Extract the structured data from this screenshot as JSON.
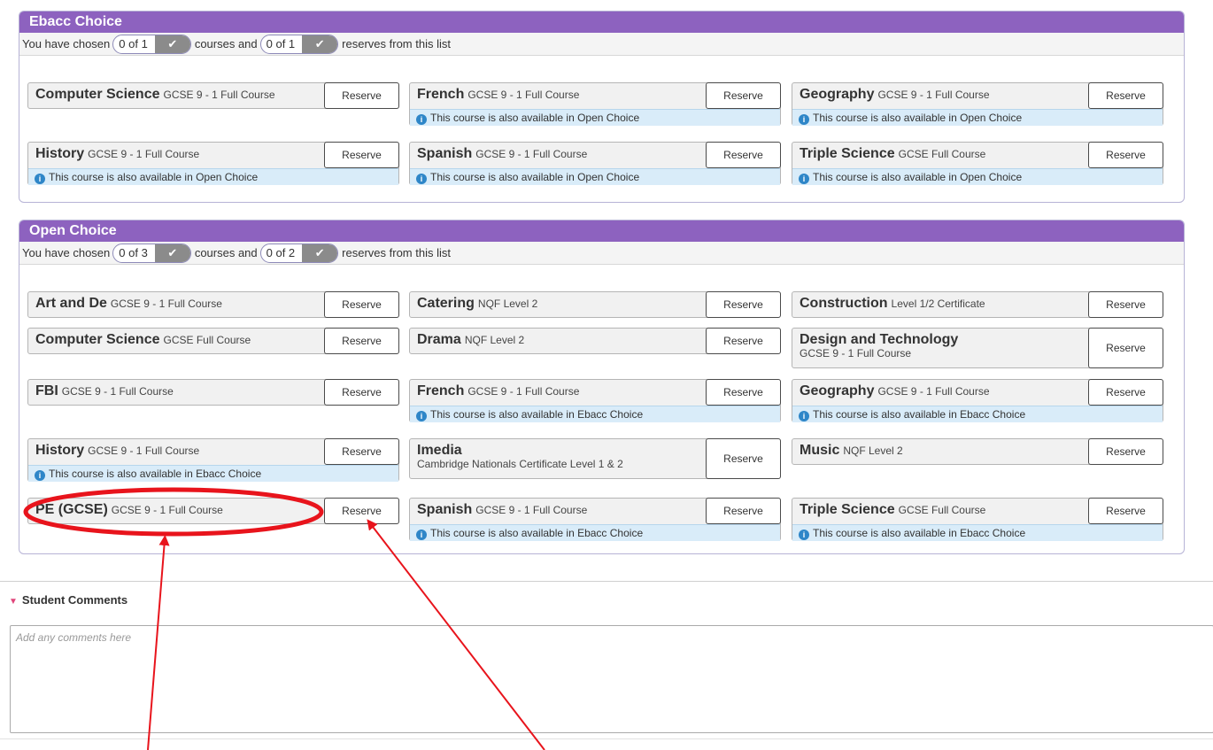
{
  "ebacc": {
    "title": "Ebacc Choice",
    "chosen_prefix": "You have chosen",
    "courses_value": "0 of 1",
    "courses_mid": "courses and",
    "reserves_value": "0 of 1",
    "reserves_suffix": "reserves from this list",
    "courses": [
      {
        "name": "Computer Science",
        "level": "GCSE 9 - 1 Full Course",
        "reserve": "Reserve",
        "note": ""
      },
      {
        "name": "French",
        "level": "GCSE 9 - 1 Full Course",
        "reserve": "Reserve",
        "note": "This course is also available in Open Choice"
      },
      {
        "name": "Geography",
        "level": "GCSE 9 - 1 Full Course",
        "reserve": "Reserve",
        "note": "This course is also available in Open Choice"
      },
      {
        "name": "History",
        "level": "GCSE 9 - 1 Full Course",
        "reserve": "Reserve",
        "note": "This course is also available in Open Choice"
      },
      {
        "name": "Spanish",
        "level": "GCSE 9 - 1 Full Course",
        "reserve": "Reserve",
        "note": "This course is also available in Open Choice"
      },
      {
        "name": "Triple Science",
        "level": "GCSE Full Course",
        "reserve": "Reserve",
        "note": "This course is also available in Open Choice"
      }
    ]
  },
  "open": {
    "title": "Open Choice",
    "chosen_prefix": "You have chosen",
    "courses_value": "0 of 3",
    "courses_mid": "courses and",
    "reserves_value": "0 of 2",
    "reserves_suffix": "reserves from this list",
    "courses": [
      {
        "name": "Art and De",
        "level": "GCSE 9 - 1 Full Course",
        "reserve": "Reserve",
        "note": ""
      },
      {
        "name": "Catering",
        "level": "NQF Level 2",
        "reserve": "Reserve",
        "note": ""
      },
      {
        "name": "Construction",
        "level": "Level 1/2 Certificate",
        "reserve": "Reserve",
        "note": ""
      },
      {
        "name": "Computer Science",
        "level": "GCSE Full Course",
        "reserve": "Reserve",
        "note": ""
      },
      {
        "name": "Drama",
        "level": "NQF Level 2",
        "reserve": "Reserve",
        "note": ""
      },
      {
        "name": "Design and Technology",
        "level": "GCSE 9 - 1 Full Course",
        "reserve": "Reserve",
        "note": ""
      },
      {
        "name": "FBI",
        "level": "GCSE 9 - 1 Full Course",
        "reserve": "Reserve",
        "note": ""
      },
      {
        "name": "French",
        "level": "GCSE 9 - 1 Full Course",
        "reserve": "Reserve",
        "note": "This course is also available in Ebacc Choice"
      },
      {
        "name": "Geography",
        "level": "GCSE 9 - 1 Full Course",
        "reserve": "Reserve",
        "note": "This course is also available in Ebacc Choice"
      },
      {
        "name": "History",
        "level": "GCSE 9 - 1 Full Course",
        "reserve": "Reserve",
        "note": "This course is also available in Ebacc Choice"
      },
      {
        "name": "Imedia",
        "level": "Cambridge Nationals Certificate Level 1 & 2",
        "reserve": "Reserve",
        "note": ""
      },
      {
        "name": "Music",
        "level": "NQF Level 2",
        "reserve": "Reserve",
        "note": ""
      },
      {
        "name": "PE (GCSE)",
        "level": "GCSE 9 - 1 Full Course",
        "reserve": "Reserve",
        "note": ""
      },
      {
        "name": "Spanish",
        "level": "GCSE 9 - 1 Full Course",
        "reserve": "Reserve",
        "note": "This course is also available in Ebacc Choice"
      },
      {
        "name": "Triple Science",
        "level": "GCSE Full Course",
        "reserve": "Reserve",
        "note": "This course is also available in Ebacc Choice"
      }
    ]
  },
  "comments": {
    "label": "Student Comments",
    "placeholder": "Add any comments here"
  },
  "annotation_color": "#e8141c",
  "colors": {
    "header": "#8d62bf",
    "note_bg": "#d9ecf9",
    "info": "#2e86c8"
  }
}
